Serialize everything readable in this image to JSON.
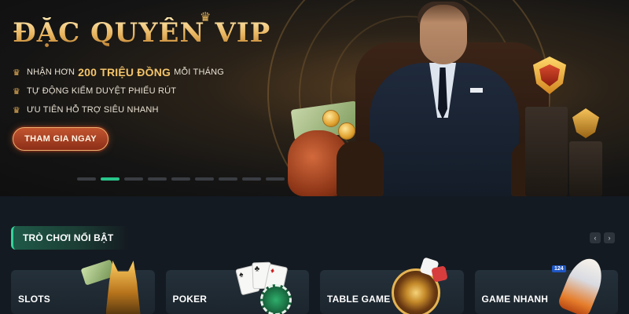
{
  "hero": {
    "title": "ĐẶC QUYỀN VIP",
    "perks": [
      {
        "pre": "NHẬN HƠN",
        "highlight": "200 TRIỆU ĐỒNG",
        "post": "MỖI THÁNG"
      },
      {
        "pre": "TỰ ĐỘNG KIỂM DUYỆT PHIẾU RÚT",
        "highlight": "",
        "post": ""
      },
      {
        "pre": "ƯU TIÊN HỖ TRỢ SIÊU NHANH",
        "highlight": "",
        "post": ""
      }
    ],
    "cta_label": "THAM GIA NGAY",
    "slides_total": 9,
    "slide_active": 2
  },
  "section": {
    "title": "TRÒ CHƠI NỔI BẬT",
    "prev_icon": "chevron-left-icon",
    "next_icon": "chevron-right-icon"
  },
  "cards": [
    {
      "label": "SLOTS"
    },
    {
      "label": "POKER"
    },
    {
      "label": "TABLE GAME"
    },
    {
      "label": "GAME NHANH",
      "badge": "124"
    }
  ],
  "colors": {
    "accent": "#29c48a",
    "gold": "#f2c879",
    "cta": "#c2552f",
    "background": "#141a21"
  }
}
